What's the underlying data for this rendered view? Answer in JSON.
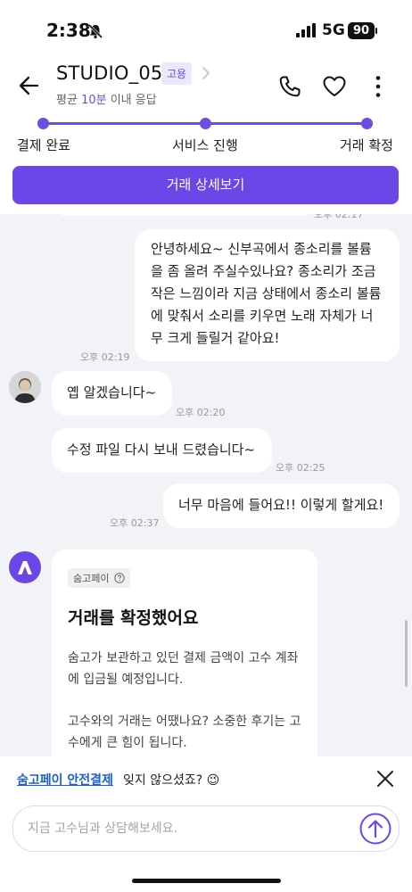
{
  "status_bar": {
    "time": "2:38",
    "network": "5G",
    "battery": "90"
  },
  "header": {
    "title": "STUDIO_05",
    "badge": "고용",
    "response_prefix": "평균",
    "response_value": "10분",
    "response_suffix": "이내 응답"
  },
  "progress": {
    "steps": [
      {
        "label": "결제 완료"
      },
      {
        "label": "서비스 진행"
      },
      {
        "label": "거래 확정"
      }
    ]
  },
  "detail_button": {
    "label": "거래 상세보기"
  },
  "chat": {
    "partial_timestamp": "오후 02:17",
    "messages": [
      {
        "side": "right",
        "text": "안녕하세요~ 신부곡에서 종소리를 볼륨을 좀 올려 주실수있나요? 종소리가 조금 작은 느낌이라 지금 상태에서 종소리 볼륨에 맞춰서 소리를 키우면 노래 자체가 너무 크게 들릴거 같아요!",
        "time": "오후 02:19"
      },
      {
        "side": "left",
        "text": "옙 알겠습니다~",
        "time": "오후 02:20"
      },
      {
        "side": "left",
        "text": "수정 파일 다시 보내 드렸습니다~",
        "time": "오후 02:25"
      },
      {
        "side": "right",
        "text": "너무 마음에 들어요!! 이렇게 할게요!",
        "time": "오후 02:37"
      }
    ],
    "pay_card": {
      "tag": "숨고페이",
      "title": "거래를 확정했어요",
      "body1": "숨고가 보관하고 있던 결제 금액이 고수 계좌에 입금될 예정입니다.",
      "body2": "고수와의 거래는 어땠나요? 소중한 후기는 고수에게 큰 힘이 됩니다."
    }
  },
  "notice": {
    "link": "숨고페이 안전결제",
    "text": "잊지 않으셨죠? 😉"
  },
  "input": {
    "placeholder": "지금 고수님과 상담해보세요."
  },
  "colors": {
    "accent": "#6b47e8",
    "link": "#1b5fd6"
  }
}
